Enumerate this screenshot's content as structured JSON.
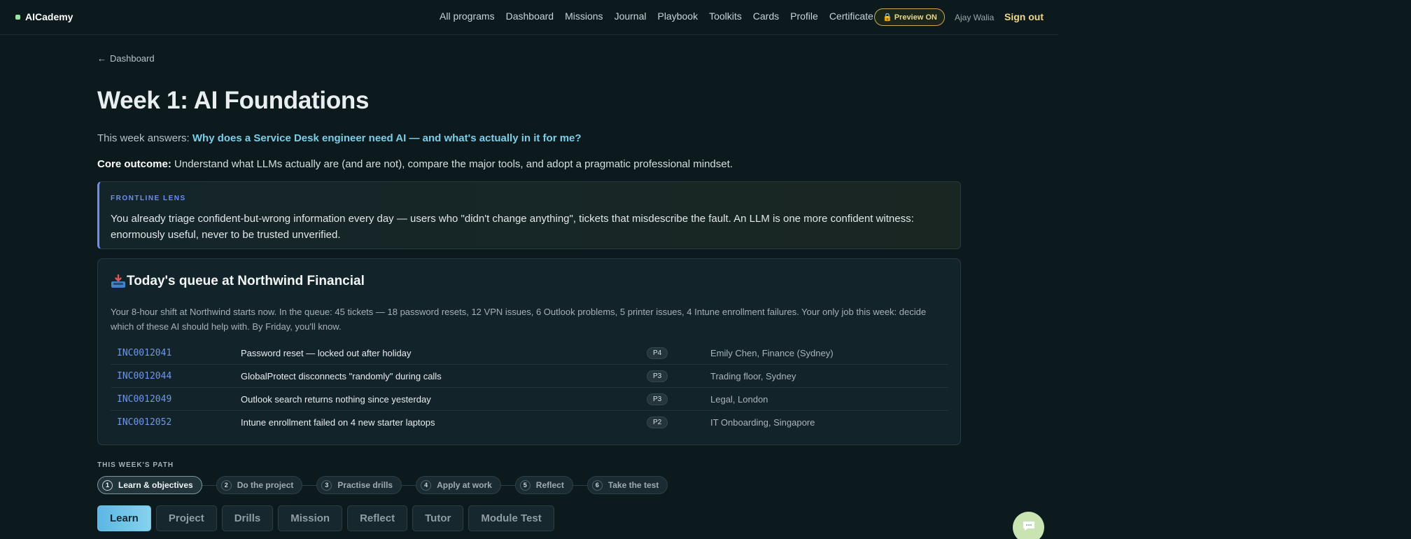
{
  "brand": {
    "name": "AICademy"
  },
  "nav": {
    "items": [
      "All programs",
      "Dashboard",
      "Missions",
      "Journal",
      "Playbook",
      "Toolkits",
      "Cards",
      "Profile",
      "Certificate"
    ],
    "preview_label": "Preview ON",
    "user_name": "Ajay Walia",
    "signout_label": "Sign out"
  },
  "breadcrumb": {
    "label": "Dashboard"
  },
  "page": {
    "title": "Week 1: AI Foundations",
    "answers_prefix": "This week answers:",
    "answers_question": "Why does a Service Desk engineer need AI — and what's actually in it for me?",
    "outcome_label": "Core outcome:",
    "outcome_text": "Understand what LLMs actually are (and are not), compare the major tools, and adopt a pragmatic professional mindset."
  },
  "lens": {
    "label": "FRONTLINE LENS",
    "text": "You already triage confident-but-wrong information every day — users who \"didn't change anything\", tickets that misdescribe the fault. An LLM is one more confident witness: enormously useful, never to be trusted unverified."
  },
  "queue": {
    "title": "Today's queue at Northwind Financial",
    "description": "Your 8-hour shift at Northwind starts now. In the queue: 45 tickets — 18 password resets, 12 VPN issues, 6 Outlook problems, 5 printer issues, 4 Intune enrollment failures. Your only job this week: decide which of these AI should help with. By Friday, you'll know.",
    "tickets": [
      {
        "id": "INC0012041",
        "summary": "Password reset — locked out after holiday",
        "priority": "P4",
        "requester": "Emily Chen, Finance (Sydney)"
      },
      {
        "id": "INC0012044",
        "summary": "GlobalProtect disconnects \"randomly\" during calls",
        "priority": "P3",
        "requester": "Trading floor, Sydney"
      },
      {
        "id": "INC0012049",
        "summary": "Outlook search returns nothing since yesterday",
        "priority": "P3",
        "requester": "Legal, London"
      },
      {
        "id": "INC0012052",
        "summary": "Intune enrollment failed on 4 new starter laptops",
        "priority": "P2",
        "requester": "IT Onboarding, Singapore"
      }
    ]
  },
  "path": {
    "label": "THIS WEEK'S PATH",
    "steps": [
      {
        "num": "1",
        "label": "Learn & objectives"
      },
      {
        "num": "2",
        "label": "Do the project"
      },
      {
        "num": "3",
        "label": "Practise drills"
      },
      {
        "num": "4",
        "label": "Apply at work"
      },
      {
        "num": "5",
        "label": "Reflect"
      },
      {
        "num": "6",
        "label": "Take the test"
      }
    ]
  },
  "tabs": [
    "Learn",
    "Project",
    "Drills",
    "Mission",
    "Reflect",
    "Tutor",
    "Module Test"
  ],
  "colors": {
    "accent": "#6fc2e8",
    "brand_dot": "#9be3a6",
    "lens_border": "#6e8ef2",
    "signout": "#f0d78a"
  }
}
